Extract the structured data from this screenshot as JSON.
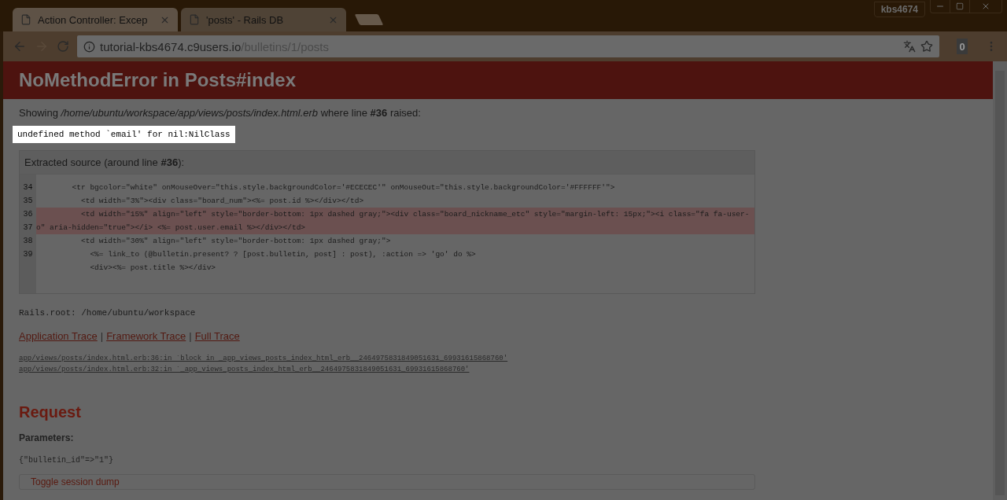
{
  "window": {
    "profile": "kbs4674"
  },
  "tabs": [
    {
      "title": "Action Controller: Excep",
      "selected": true
    },
    {
      "title": "'posts' - Rails DB",
      "selected": false
    }
  ],
  "toolbar": {
    "back_enabled": true,
    "forward_enabled": false,
    "url_host": "tutorial-kbs4674.c9users.io",
    "url_path": "/bulletins/1/posts",
    "extension_badge": "0"
  },
  "page": {
    "title": "NoMethodError in Posts#index",
    "showing": "Showing */home/ubuntu/workspace/app/views/posts/index.html.erb* where line **#36** raised:",
    "message": "undefined method `email' for nil:NilClass",
    "source": {
      "heading": "Extracted source (around line **#36**):",
      "lines": [
        {
          "number": "34",
          "code": "        <tr bgcolor=\"white\" onMouseOver=\"this.style.backgroundColor='#ECECEC'\" onMouseOut=\"this.style.backgroundColor='#FFFFFF'\">",
          "highlighted": false
        },
        {
          "number": "35",
          "code": "          <td width=\"3%\"><div class=\"board_num\"><%= post.id %></div></td>",
          "highlighted": false
        },
        {
          "number": "36",
          "code": "          <td width=\"15%\" align=\"left\" style=\"border-bottom: 1px dashed gray;\"><div class=\"board_nickname_etc\" style=\"margin-left: 15px;\"><i class=\"fa fa-user-o\" aria-hidden=\"true\"></i> <%= post.user.email %></div></td>",
          "highlighted": true
        },
        {
          "number": "37",
          "code": "          <td width=\"30%\" align=\"left\" style=\"border-bottom: 1px dashed gray;\">",
          "highlighted": false
        },
        {
          "number": "38",
          "code": "            <%= link_to (@bulletin.present? ? [post.bulletin, post] : post), :action => 'go' do %>",
          "highlighted": false
        },
        {
          "number": "39",
          "code": "            <div><%= post.title %></div>",
          "highlighted": false
        }
      ]
    },
    "rails_root": "Rails.root: /home/ubuntu/workspace",
    "trace_links": [
      "Application Trace",
      "Framework Trace",
      "Full Trace"
    ],
    "trace_separator": "|",
    "trace": [
      "app/views/posts/index.html.erb:36:in `block in _app_views_posts_index_html_erb__2464975831849051631_69931615868760'",
      "app/views/posts/index.html.erb:32:in `_app_views_posts_index_html_erb__2464975831849051631_69931615868760'"
    ],
    "request": {
      "heading": "Request",
      "parameters_label": "Parameters:",
      "parameters": "{\"bulletin_id\"=>\"1\"}",
      "session_toggle": "Toggle session dump"
    }
  }
}
